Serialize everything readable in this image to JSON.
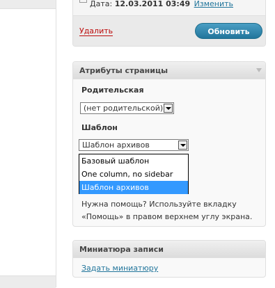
{
  "publish": {
    "date_label": "Дата:",
    "date_value": "12.03.2011 03:49",
    "change_link": "Изменить",
    "delete_link": "Удалить",
    "update_button": "Обновить"
  },
  "page_attributes": {
    "title": "Атрибуты страницы",
    "parent_label": "Родительская",
    "parent_selected": "(нет родительской)",
    "template_label": "Шаблон",
    "template_selected": "Шаблон архивов",
    "template_options": [
      "Базовый шаблон",
      "One column, no sidebar",
      "Шаблон архивов"
    ],
    "help_text": "Нужна помощь? Используйте вкладку «Помощь» в правом верхнем углу экрана."
  },
  "thumbnail": {
    "title": "Миниатюра записи",
    "set_link": "Задать миниатюру"
  },
  "colors": {
    "link": "#21759b",
    "delete": "#bc0b0b",
    "button": "#21759b",
    "selected_option": "#3399ff"
  }
}
